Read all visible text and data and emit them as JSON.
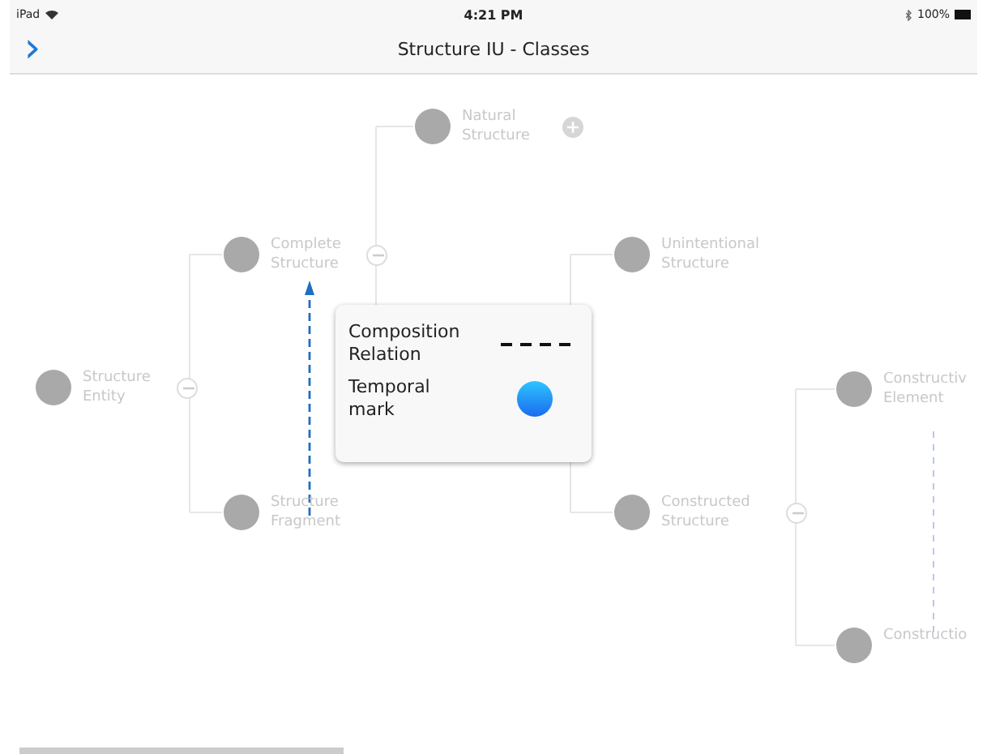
{
  "status_bar": {
    "device": "iPad",
    "time": "4:21 PM",
    "battery": "100%"
  },
  "nav_bar": {
    "back": "›",
    "title": "Structure IU - Classes"
  },
  "nodes": [
    {
      "label": "Natural Structure",
      "expanded": false
    },
    {
      "label": "Complete Structure",
      "expanded": true
    },
    {
      "label": "Structure Entity",
      "expanded": true
    },
    {
      "label": "Structure Fragment"
    },
    {
      "label": "Unintentional Structure"
    },
    {
      "label": "Constructed Structure",
      "expanded": true
    },
    {
      "label": "Constructiv Element"
    },
    {
      "label": "Constructio"
    }
  ],
  "legend": [
    {
      "label": "Composition Relation",
      "kind": "dashed-line"
    },
    {
      "label": "Temporal mark",
      "kind": "dot"
    }
  ]
}
